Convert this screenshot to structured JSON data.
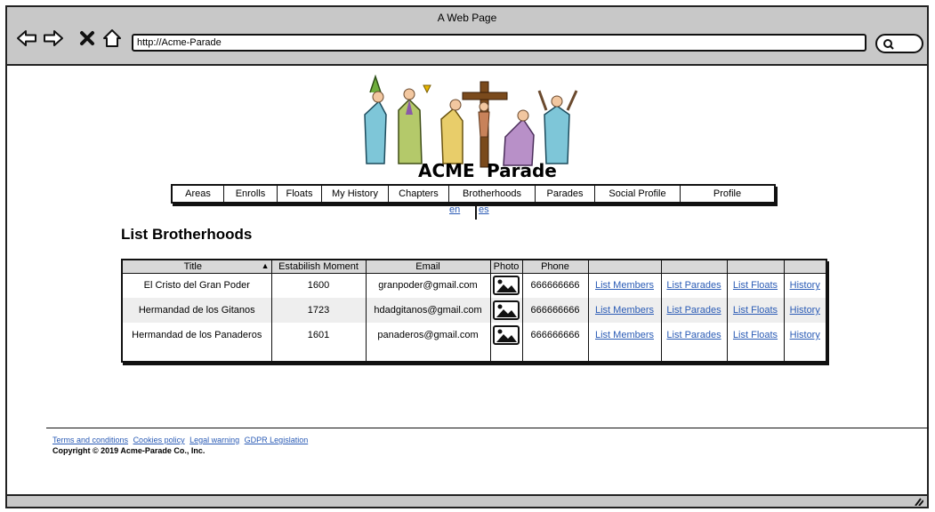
{
  "browser": {
    "title": "A Web Page",
    "url": "http://Acme-Parade"
  },
  "logo": {
    "word1": "ACME",
    "word2": "Parade"
  },
  "menu": {
    "items": [
      "Areas",
      "Enrolls",
      "Floats",
      "My History",
      "Chapters",
      "Brotherhoods",
      "Parades",
      "Social Profile",
      "Profile"
    ]
  },
  "lang": {
    "en": "en",
    "es": "es"
  },
  "page": {
    "title": "List Brotherhoods"
  },
  "table": {
    "headers": [
      "Title",
      "Estabilish Moment",
      "Email",
      "Photo",
      "Phone",
      "",
      "",
      "",
      ""
    ],
    "rows": [
      {
        "title": "El Cristo del Gran Poder",
        "moment": "1600",
        "email": "granpoder@gmail.com",
        "phone": "666666666",
        "members": "List Members",
        "parades": "List Parades",
        "floats": "List Floats",
        "history": "History"
      },
      {
        "title": "Hermandad de los Gitanos",
        "moment": "1723",
        "email": "hdadgitanos@gmail.com",
        "phone": "666666666",
        "members": "List Members",
        "parades": "List Parades",
        "floats": "List Floats",
        "history": "History"
      },
      {
        "title": "Hermandad de los Panaderos",
        "moment": "1601",
        "email": "panaderos@gmail.com",
        "phone": "666666666",
        "members": "List Members",
        "parades": "List Parades",
        "floats": "List Floats",
        "history": "History"
      }
    ]
  },
  "footer": {
    "links": [
      "Terms and conditions",
      "Cookies policy",
      "Legal warning",
      "GDPR Legislation"
    ],
    "copyright": "Copyright © 2019 Acme-Parade Co., Inc."
  }
}
